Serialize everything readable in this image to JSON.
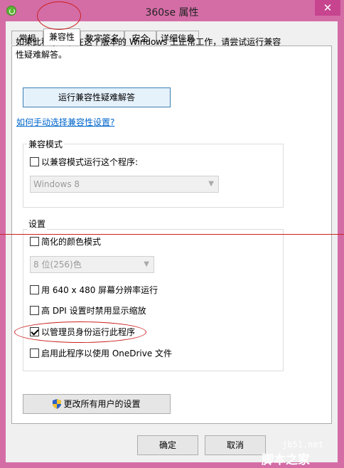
{
  "window": {
    "title": "360se 属性",
    "close_glyph": "✕"
  },
  "tabs": [
    "常规",
    "兼容性",
    "数字签名",
    "安全",
    "详细信息"
  ],
  "description": "如果此程序不能在这个版本的 Windows 上正常工作，请尝试运行兼容性疑难解答。",
  "troubleshoot_button": "运行兼容性疑难解答",
  "manual_link": "如何手动选择兼容性设置?",
  "compat_mode": {
    "group_title": "兼容模式",
    "checkbox_label": "以兼容模式运行这个程序:",
    "checked": false,
    "select_value": "Windows 8"
  },
  "settings": {
    "group_title": "设置",
    "reduced_color": {
      "label": "简化的颜色模式",
      "checked": false
    },
    "color_select_value": "8 位(256)色",
    "resolution": {
      "label": "用 640 x 480 屏幕分辨率运行",
      "checked": false
    },
    "dpi": {
      "label": "高 DPI 设置时禁用显示缩放",
      "checked": false
    },
    "admin": {
      "label": "以管理员身份运行此程序",
      "checked": true
    },
    "onedrive": {
      "label": "启用此程序以使用 OneDrive 文件",
      "checked": false
    }
  },
  "all_users_button": "更改所有用户的设置",
  "ok_button": "确定",
  "cancel_button": "取消",
  "watermark": {
    "url": "jb51.net",
    "logo": "脚本之家"
  },
  "colors": {
    "window_frame": "#d46da6",
    "annotation_red": "#cc1f1f",
    "link_blue": "#0066cc"
  }
}
